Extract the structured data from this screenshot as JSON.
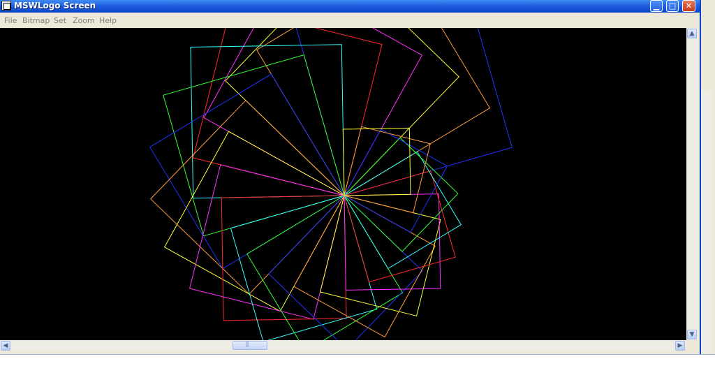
{
  "window": {
    "title": "MSWLogo Screen",
    "controls": {
      "minimize": "▁",
      "maximize": "□",
      "close": "✕"
    }
  },
  "menu": [
    "File",
    "Bitmap",
    "Set",
    "Zoom",
    "Help"
  ],
  "scroll": {
    "up": "▲",
    "down": "▼",
    "left": "◀",
    "right": "▶"
  },
  "drawing": {
    "description_icon": "turtle-spiral-squares",
    "background": "#000000",
    "colors": [
      "#1f32ff",
      "#ff9e3d",
      "#ffff33",
      "#ff33ff",
      "#ff2a2a",
      "#33ffff",
      "#33ff33"
    ]
  }
}
